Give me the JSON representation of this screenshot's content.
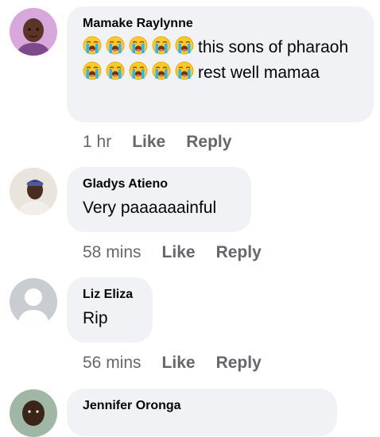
{
  "comments": [
    {
      "author": "Mamake Raylynne",
      "text_part1": "this sons of pharaoh",
      "text_part2": "rest well mamaa",
      "time": "1 hr",
      "like_label": "Like",
      "reply_label": "Reply",
      "emoji_icon": "loudly-crying-face-icon",
      "emoji_group1_count": 5,
      "emoji_group2_count": 5
    },
    {
      "author": "Gladys Atieno",
      "text": "Very paaaaaainful",
      "time": "58 mins",
      "like_label": "Like",
      "reply_label": "Reply"
    },
    {
      "author": "Liz Eliza",
      "text": "Rip",
      "time": "56 mins",
      "like_label": "Like",
      "reply_label": "Reply"
    },
    {
      "author": "Jennifer Oronga"
    }
  ],
  "colors": {
    "bubble_bg": "#f0f2f5",
    "author_text": "#050505",
    "meta_text": "#65676b",
    "default_avatar": "#c9ccd1"
  }
}
